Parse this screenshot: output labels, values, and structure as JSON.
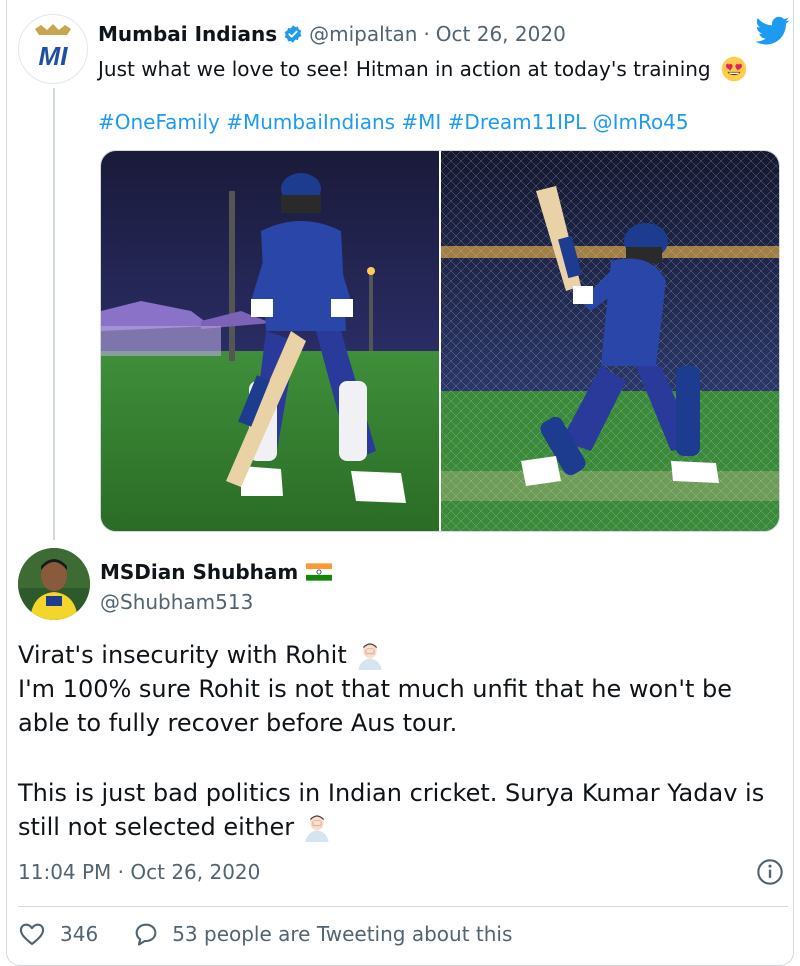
{
  "quoted_tweet": {
    "author_name": "Mumbai Indians",
    "handle": "@mipaltan",
    "separator": "·",
    "date": "Oct 26, 2020",
    "text": "Just what we love to see! Hitman in action at today's training",
    "emoji": "smiling-face-with-heart-eyes",
    "hashtags": "#OneFamily #MumbaiIndians #MI #Dream11IPL @ImRo45",
    "logo_text": "MI",
    "photos": [
      {
        "description_icon": "player-walking-photo"
      },
      {
        "description_icon": "player-batting-nets-photo"
      }
    ]
  },
  "reply_tweet": {
    "author_name": "MSDian Shubham",
    "flag": "india-flag",
    "handle": "@Shubham513",
    "lines": [
      "Virat's insecurity with Rohit",
      "I'm 100% sure Rohit is not that much unfit that he won't be",
      "able to fully recover before Aus tour.",
      "This is just bad politics in Indian cricket. Surya Kumar Yadav is",
      "still not selected either"
    ],
    "emoji": "man-facepalming",
    "timestamp": "11:04 PM · Oct 26, 2020",
    "likes": "346",
    "replies_text": "53 people are Tweeting about this"
  },
  "colors": {
    "link": "#1d9bf0",
    "muted": "#536471",
    "border": "#cfd9de",
    "mi_blue": "#1f4fa0",
    "mi_gold": "#c8a64b"
  }
}
